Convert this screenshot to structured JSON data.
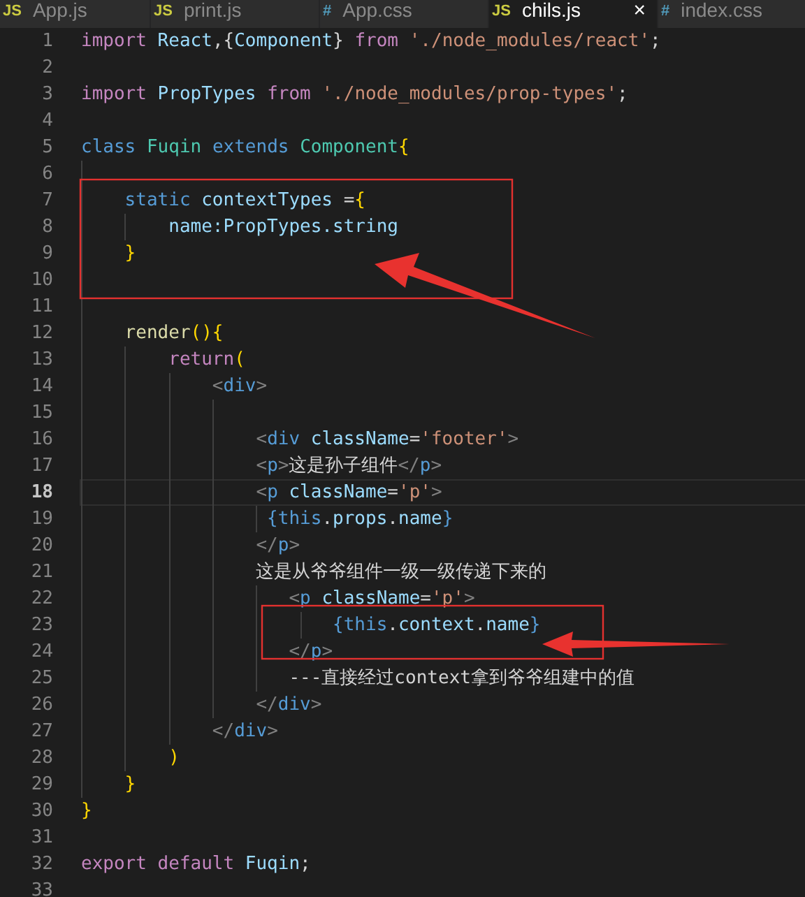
{
  "tabs": [
    {
      "kind": "js",
      "icon": "JS",
      "label": "App.js",
      "selected": false
    },
    {
      "kind": "js",
      "icon": "JS",
      "label": "print.js",
      "selected": false
    },
    {
      "kind": "css",
      "icon": "#",
      "label": "App.css",
      "selected": false
    },
    {
      "kind": "js",
      "icon": "JS",
      "label": "chils.js",
      "selected": true,
      "close": "×"
    },
    {
      "kind": "css",
      "icon": "#",
      "label": "index.css",
      "selected": false
    }
  ],
  "lines": [
    {
      "number": "1",
      "current": false,
      "tokens": [
        {
          "kind": "keyword",
          "text": "import "
        },
        {
          "kind": "variable",
          "text": "React"
        },
        {
          "kind": "plain",
          "text": ",{"
        },
        {
          "kind": "variable",
          "text": "Component"
        },
        {
          "kind": "plain",
          "text": "} "
        },
        {
          "kind": "keyword",
          "text": "from "
        },
        {
          "kind": "string",
          "text": "'./node_modules/react'"
        },
        {
          "kind": "plain",
          "text": ";"
        }
      ]
    },
    {
      "number": "2",
      "current": false
    },
    {
      "number": "3",
      "current": false,
      "tokens": [
        {
          "kind": "keyword",
          "text": "import "
        },
        {
          "kind": "variable",
          "text": "PropTypes "
        },
        {
          "kind": "keyword",
          "text": "from "
        },
        {
          "kind": "string",
          "text": "'./node_modules/prop-types'"
        },
        {
          "kind": "plain",
          "text": ";"
        }
      ]
    },
    {
      "number": "4",
      "current": false
    },
    {
      "number": "5",
      "current": false,
      "tokens": [
        {
          "kind": "storage",
          "text": "class "
        },
        {
          "kind": "type",
          "text": "Fuqin "
        },
        {
          "kind": "storage",
          "text": "extends "
        },
        {
          "kind": "type",
          "text": "Component"
        },
        {
          "kind": "brace",
          "text": "{"
        }
      ]
    },
    {
      "number": "6",
      "current": false
    },
    {
      "number": "7",
      "current": false,
      "tokens": [
        {
          "kind": "storage",
          "text": "    static "
        },
        {
          "kind": "variable",
          "text": "contextTypes "
        },
        {
          "kind": "plain",
          "text": "="
        },
        {
          "kind": "brace",
          "text": "{"
        }
      ]
    },
    {
      "number": "8",
      "current": false,
      "tokens": [
        {
          "kind": "variable",
          "text": "        name:PropTypes.string"
        }
      ]
    },
    {
      "number": "9",
      "current": false,
      "tokens": [
        {
          "kind": "brace",
          "text": "    }"
        }
      ]
    },
    {
      "number": "10",
      "current": false
    },
    {
      "number": "11",
      "current": false
    },
    {
      "number": "12",
      "current": false,
      "tokens": [
        {
          "kind": "function",
          "text": "    render"
        },
        {
          "kind": "brace",
          "text": "(){"
        }
      ]
    },
    {
      "number": "13",
      "current": false,
      "tokens": [
        {
          "kind": "keyword",
          "text": "        return"
        },
        {
          "kind": "brace",
          "text": "("
        }
      ]
    },
    {
      "number": "14",
      "current": false,
      "tokens": [
        {
          "kind": "bracket",
          "text": "            <"
        },
        {
          "kind": "tag",
          "text": "div"
        },
        {
          "kind": "bracket",
          "text": ">"
        }
      ]
    },
    {
      "number": "15",
      "current": false
    },
    {
      "number": "16",
      "current": false,
      "tokens": [
        {
          "kind": "bracket",
          "text": "                <"
        },
        {
          "kind": "tag",
          "text": "div "
        },
        {
          "kind": "variable",
          "text": "className"
        },
        {
          "kind": "plain",
          "text": "="
        },
        {
          "kind": "string",
          "text": "'footer'"
        },
        {
          "kind": "bracket",
          "text": ">"
        }
      ]
    },
    {
      "number": "17",
      "current": false,
      "tokens": [
        {
          "kind": "bracket",
          "text": "                <"
        },
        {
          "kind": "tag",
          "text": "p"
        },
        {
          "kind": "bracket",
          "text": ">"
        },
        {
          "kind": "plain",
          "text": "这是孙子组件"
        },
        {
          "kind": "bracket",
          "text": "</"
        },
        {
          "kind": "tag",
          "text": "p"
        },
        {
          "kind": "bracket",
          "text": ">"
        }
      ]
    },
    {
      "number": "18",
      "current": true,
      "tokens": [
        {
          "kind": "bracket",
          "text": "                <"
        },
        {
          "kind": "tag",
          "text": "p "
        },
        {
          "kind": "variable",
          "text": "className"
        },
        {
          "kind": "plain",
          "text": "="
        },
        {
          "kind": "string",
          "text": "'p'"
        },
        {
          "kind": "bracket",
          "text": ">"
        }
      ]
    },
    {
      "number": "19",
      "current": false,
      "tokens": [
        {
          "kind": "tag",
          "text": "                 {"
        },
        {
          "kind": "storage",
          "text": "this"
        },
        {
          "kind": "plain",
          "text": "."
        },
        {
          "kind": "variable",
          "text": "props"
        },
        {
          "kind": "plain",
          "text": "."
        },
        {
          "kind": "variable",
          "text": "name"
        },
        {
          "kind": "tag",
          "text": "}"
        }
      ]
    },
    {
      "number": "20",
      "current": false,
      "tokens": [
        {
          "kind": "bracket",
          "text": "                </"
        },
        {
          "kind": "tag",
          "text": "p"
        },
        {
          "kind": "bracket",
          "text": ">"
        }
      ]
    },
    {
      "number": "21",
      "current": false,
      "tokens": [
        {
          "kind": "plain",
          "text": "                这是从爷爷组件一级一级传递下来的"
        }
      ]
    },
    {
      "number": "22",
      "current": false,
      "tokens": [
        {
          "kind": "bracket",
          "text": "                   <"
        },
        {
          "kind": "tag",
          "text": "p "
        },
        {
          "kind": "variable",
          "text": "className"
        },
        {
          "kind": "plain",
          "text": "="
        },
        {
          "kind": "string",
          "text": "'p'"
        },
        {
          "kind": "bracket",
          "text": ">"
        }
      ]
    },
    {
      "number": "23",
      "current": false,
      "tokens": [
        {
          "kind": "tag",
          "text": "                       {"
        },
        {
          "kind": "storage",
          "text": "this"
        },
        {
          "kind": "plain",
          "text": "."
        },
        {
          "kind": "variable",
          "text": "context"
        },
        {
          "kind": "plain",
          "text": "."
        },
        {
          "kind": "variable",
          "text": "name"
        },
        {
          "kind": "tag",
          "text": "}"
        }
      ]
    },
    {
      "number": "24",
      "current": false,
      "tokens": [
        {
          "kind": "bracket",
          "text": "                   </"
        },
        {
          "kind": "tag",
          "text": "p"
        },
        {
          "kind": "bracket",
          "text": ">"
        }
      ]
    },
    {
      "number": "25",
      "current": false,
      "tokens": [
        {
          "kind": "plain",
          "text": "                   ---直接经过context拿到爷爷组建中的值"
        }
      ]
    },
    {
      "number": "26",
      "current": false,
      "tokens": [
        {
          "kind": "bracket",
          "text": "                </"
        },
        {
          "kind": "tag",
          "text": "div"
        },
        {
          "kind": "bracket",
          "text": ">"
        }
      ]
    },
    {
      "number": "27",
      "current": false,
      "tokens": [
        {
          "kind": "bracket",
          "text": "            </"
        },
        {
          "kind": "tag",
          "text": "div"
        },
        {
          "kind": "bracket",
          "text": ">"
        }
      ]
    },
    {
      "number": "28",
      "current": false,
      "tokens": [
        {
          "kind": "brace",
          "text": "        )"
        }
      ]
    },
    {
      "number": "29",
      "current": false,
      "tokens": [
        {
          "kind": "brace",
          "text": "    }"
        }
      ]
    },
    {
      "number": "30",
      "current": false,
      "tokens": [
        {
          "kind": "brace",
          "text": "}"
        }
      ]
    },
    {
      "number": "31",
      "current": false
    },
    {
      "number": "32",
      "current": false,
      "tokens": [
        {
          "kind": "keyword",
          "text": "export default "
        },
        {
          "kind": "variable",
          "text": "Fuqin"
        },
        {
          "kind": "plain",
          "text": ";"
        }
      ]
    },
    {
      "number": "33",
      "current": false
    }
  ]
}
